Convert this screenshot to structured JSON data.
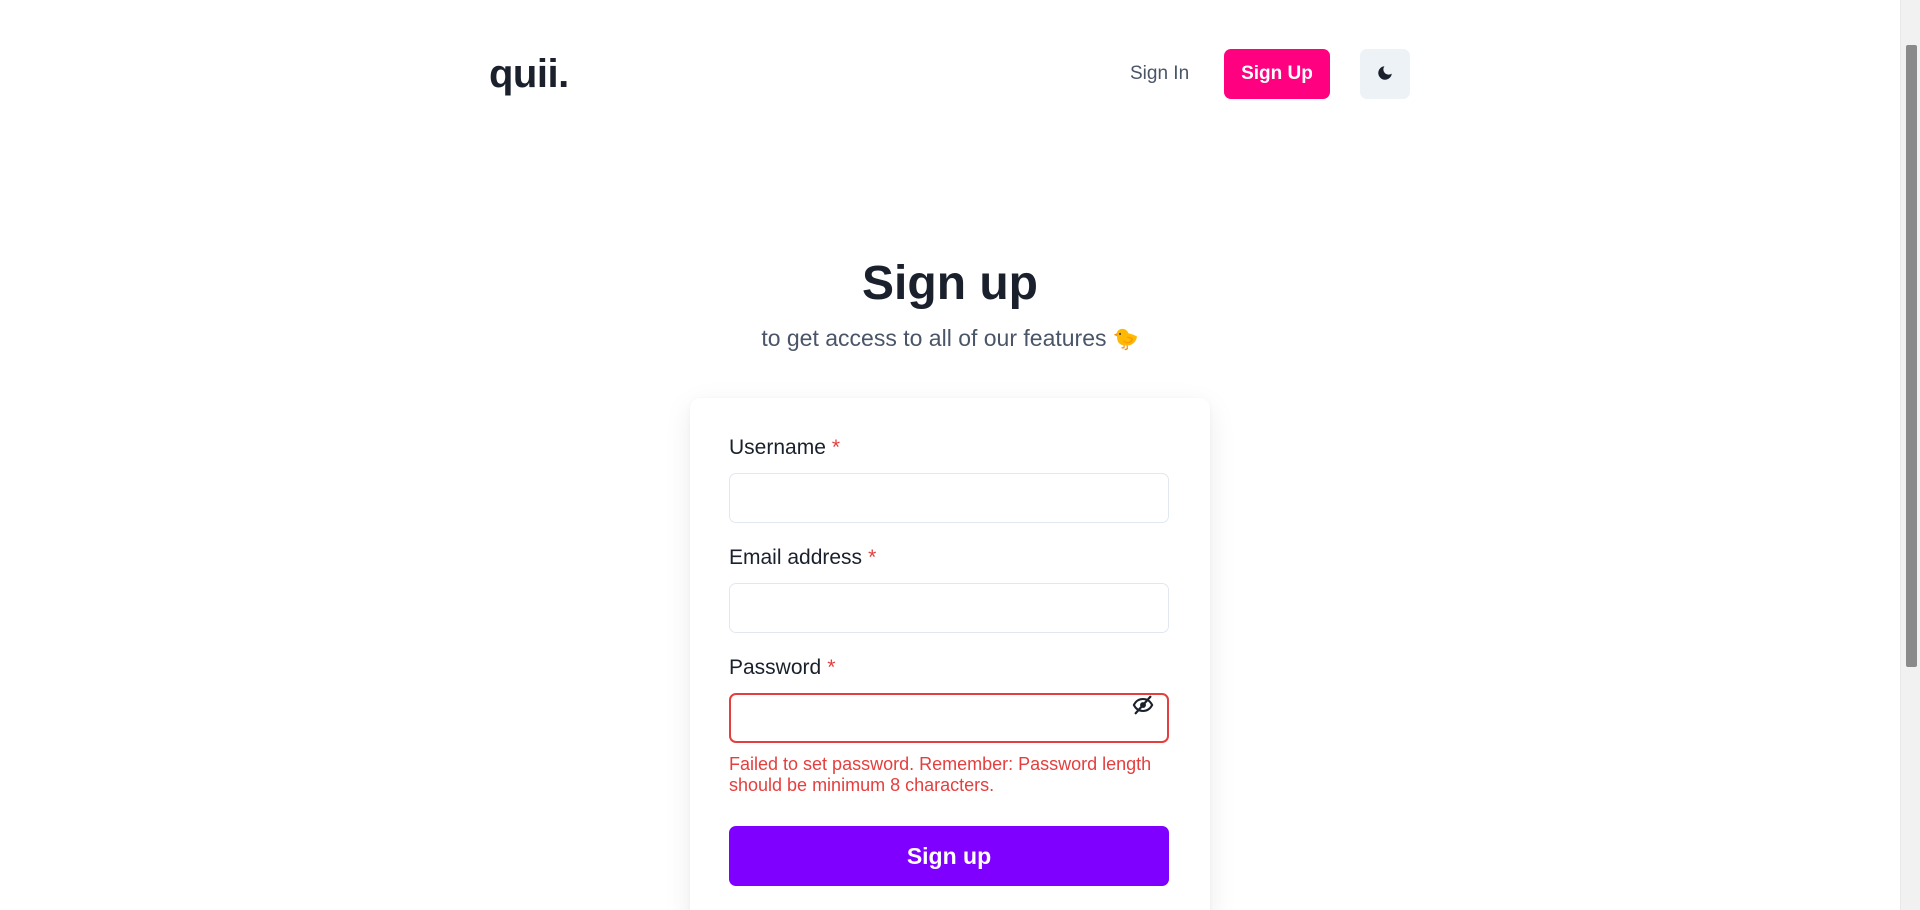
{
  "header": {
    "logo": "quii.",
    "signin_label": "Sign In",
    "signup_label": "Sign Up",
    "theme_icon": "moon-icon"
  },
  "hero": {
    "title": "Sign up",
    "subtitle": "to get access to all of our features",
    "subtitle_emoji": "🐤"
  },
  "form": {
    "required_mark": "*",
    "username": {
      "label": "Username",
      "value": ""
    },
    "email": {
      "label": "Email address",
      "value": ""
    },
    "password": {
      "label": "Password",
      "value": "",
      "toggle_icon": "eye-slash-icon",
      "error": "Failed to set password. Remember: Password length should be minimum 8 characters."
    },
    "submit_label": "Sign up"
  },
  "colors": {
    "brand_pink": "#ff0080",
    "brand_purple": "#7f00ff",
    "error_red": "#e53e3e",
    "heading": "#1a202c",
    "muted": "#4a5568"
  }
}
